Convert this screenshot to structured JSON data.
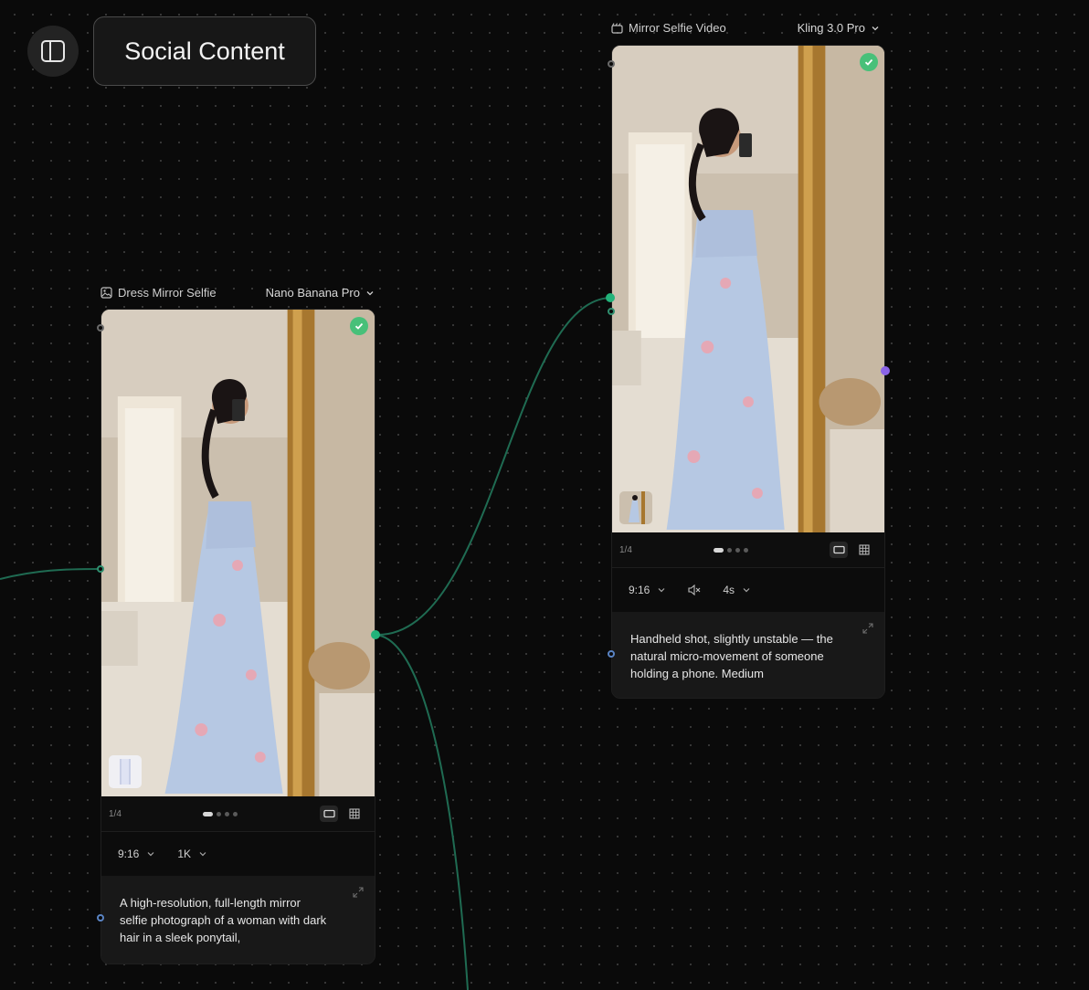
{
  "canvas": {
    "title": "Social Content"
  },
  "colors": {
    "accent_green": "#22b37a",
    "check_green": "#48c079",
    "port_purple": "#8a63e6",
    "port_blue": "#5a84c4",
    "wire": "#1f6b52"
  },
  "node_image": {
    "label": "Dress Mirror Selfie",
    "label_icon": "image-icon",
    "model": "Nano Banana Pro",
    "page_indicator": "1/4",
    "aspect_ratio": "9:16",
    "resolution": "1K",
    "prompt": "A high-resolution, full-length mirror selfie photograph of a woman with dark hair in a sleek ponytail,"
  },
  "node_video": {
    "label": "Mirror Selfie Video",
    "label_icon": "video-icon",
    "model": "Kling 3.0 Pro",
    "page_indicator": "1/4",
    "aspect_ratio": "9:16",
    "audio": "muted",
    "duration": "4s",
    "prompt": "Handheld shot, slightly unstable — the natural micro-movement of someone holding a phone. Medium"
  }
}
